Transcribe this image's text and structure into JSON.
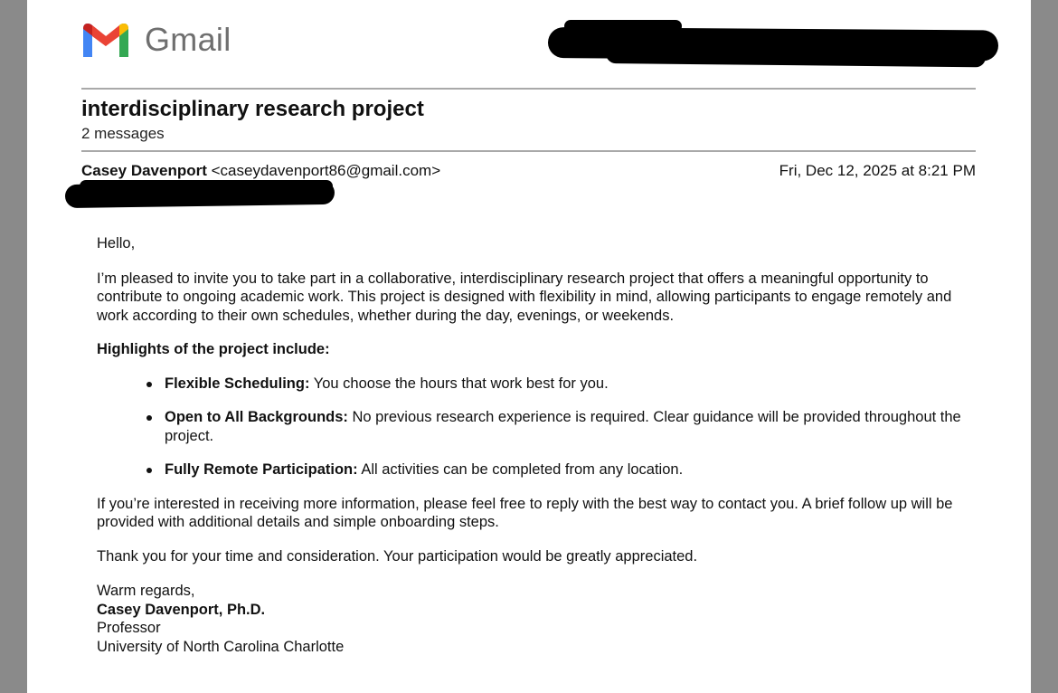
{
  "app": {
    "name": "Gmail",
    "logo_icon": "gmail-m-logo-icon",
    "colors": {
      "blue": "#4285F4",
      "green": "#34A853",
      "yellow": "#FBBC04",
      "red": "#EA4335",
      "wordmark": "#6f6f6f"
    }
  },
  "thread": {
    "subject": "interdisciplinary research project",
    "message_count": "2 messages"
  },
  "message": {
    "sender_name": "Casey Davenport",
    "sender_email": "<caseydavenport86@gmail.com>",
    "date": "Fri, Dec 12, 2025 at 8:21 PM",
    "greeting": "Hello,",
    "intro": "I’m pleased to invite you to take part in a collaborative, interdisciplinary research project that offers a meaningful opportunity to contribute to ongoing academic work. This project is designed with flexibility in mind, allowing participants to engage remotely and work according to their own schedules, whether during the day, evenings, or weekends.",
    "highlights_heading": "Highlights of the project include:",
    "highlights": [
      {
        "title": "Flexible Scheduling:",
        "text": "You choose the hours that work best for you."
      },
      {
        "title": "Open to All Backgrounds:",
        "text": "No previous research experience is required. Clear guidance will be provided throughout the project."
      },
      {
        "title": "Fully Remote Participation:",
        "text": "All activities can be completed from any location."
      }
    ],
    "followup": "If you’re interested in receiving more information, please feel free to reply with the best way to contact you. A brief follow up will be provided with additional details and simple onboarding steps.",
    "thanks": "Thank you for your time and consideration. Your participation would be greatly appreciated.",
    "signoff": "Warm regards,",
    "signature_name": "Casey Davenport, Ph.D.",
    "signature_title": "Professor",
    "signature_org": "University of North Carolina Charlotte"
  }
}
